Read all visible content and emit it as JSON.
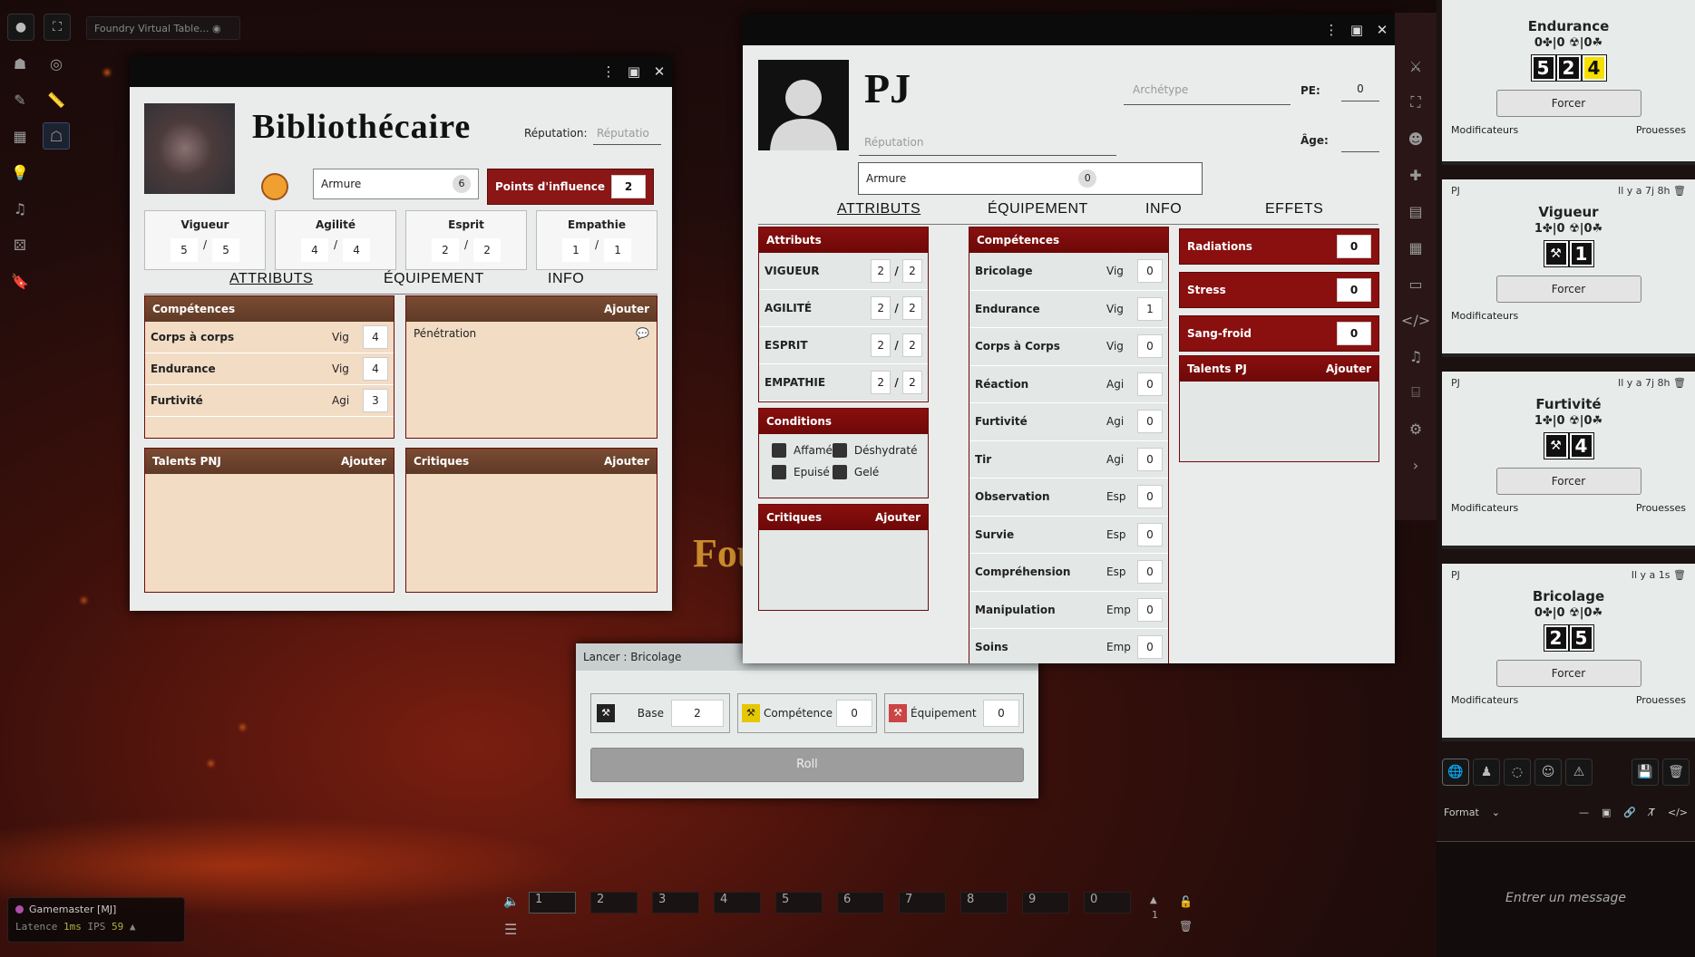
{
  "topbar": {
    "app_title": "Foundry Virtual Table..."
  },
  "npc": {
    "name": "Bibliothécaire",
    "reputation_label": "Réputation:",
    "reputation_placeholder": "Réputatio",
    "armor_label": "Armure",
    "armor_value": "6",
    "influence_label": "Points d'influence",
    "influence_value": "2",
    "attributes": [
      {
        "name": "Vigueur",
        "cur": "5",
        "max": "5"
      },
      {
        "name": "Agilité",
        "cur": "4",
        "max": "4"
      },
      {
        "name": "Esprit",
        "cur": "2",
        "max": "2"
      },
      {
        "name": "Empathie",
        "cur": "1",
        "max": "1"
      }
    ],
    "tabs": [
      "Attributs",
      "Équipement",
      "Info"
    ],
    "skills_title": "Compétences",
    "skills": [
      {
        "name": "Corps à corps",
        "attr": "Vig",
        "value": "4"
      },
      {
        "name": "Endurance",
        "attr": "Vig",
        "value": "4"
      },
      {
        "name": "Furtivité",
        "attr": "Agi",
        "value": "3"
      }
    ],
    "items_add": "Ajouter",
    "items": [
      "Pénétration"
    ],
    "talents_title": "Talents PNJ",
    "talents_add": "Ajouter",
    "crit_title": "Critiques",
    "crit_add": "Ajouter"
  },
  "pc": {
    "name": "PJ",
    "archetype_placeholder": "Archétype",
    "pe_label": "PE:",
    "pe_value": "0",
    "reputation_placeholder": "Réputation",
    "age_label": "Âge:",
    "armor_label": "Armure",
    "armor_value": "0",
    "tabs": [
      "Attributs",
      "Équipement",
      "Info",
      "Effets"
    ],
    "attr_title": "Attributs",
    "attributes": [
      {
        "name": "VIGUEUR",
        "cur": "2",
        "max": "2"
      },
      {
        "name": "AGILITÉ",
        "cur": "2",
        "max": "2"
      },
      {
        "name": "ESPRIT",
        "cur": "2",
        "max": "2"
      },
      {
        "name": "EMPATHIE",
        "cur": "2",
        "max": "2"
      }
    ],
    "conditions_title": "Conditions",
    "conditions": [
      "Affamé",
      "Déshydraté",
      "Epuisé",
      "Gelé"
    ],
    "crit_title": "Critiques",
    "crit_add": "Ajouter",
    "skills_title": "Compétences",
    "skills": [
      {
        "name": "Bricolage",
        "attr": "Vig",
        "value": "0"
      },
      {
        "name": "Endurance",
        "attr": "Vig",
        "value": "1"
      },
      {
        "name": "Corps à Corps",
        "attr": "Vig",
        "value": "0"
      },
      {
        "name": "Réaction",
        "attr": "Agi",
        "value": "0"
      },
      {
        "name": "Furtivité",
        "attr": "Agi",
        "value": "0"
      },
      {
        "name": "Tir",
        "attr": "Agi",
        "value": "0"
      },
      {
        "name": "Observation",
        "attr": "Esp",
        "value": "0"
      },
      {
        "name": "Survie",
        "attr": "Esp",
        "value": "0"
      },
      {
        "name": "Compréhension",
        "attr": "Esp",
        "value": "0"
      },
      {
        "name": "Manipulation",
        "attr": "Emp",
        "value": "0"
      },
      {
        "name": "Soins",
        "attr": "Emp",
        "value": "0"
      }
    ],
    "trackers": [
      {
        "name": "Radiations",
        "value": "0"
      },
      {
        "name": "Stress",
        "value": "0"
      },
      {
        "name": "Sang-froid",
        "value": "0"
      }
    ],
    "talents_title": "Talents PJ",
    "talents_add": "Ajouter"
  },
  "roll": {
    "title": "Lancer : Bricolage",
    "base_label": "Base",
    "base_value": "2",
    "skill_label": "Compétence",
    "skill_value": "0",
    "equip_label": "Équipement",
    "equip_value": "0",
    "roll_button": "Roll"
  },
  "chat": {
    "cards": [
      {
        "author": "",
        "time": "",
        "skill": "Endurance",
        "summary": "0✤|0 ☢|0☘",
        "dice": [
          "5",
          "2",
          "4"
        ],
        "yellow": [
          2
        ],
        "force": "Forcer",
        "mods": "Modificateurs",
        "feats": "Prouesses"
      },
      {
        "author": "PJ",
        "time": "Il y a 7j 8h",
        "skill": "Vigueur",
        "summary": "1✤|0 ☢|0☘",
        "dice": [
          "⚒",
          "1"
        ],
        "yellow": [],
        "force": "Forcer",
        "mods": "Modificateurs",
        "feats": ""
      },
      {
        "author": "PJ",
        "time": "Il y a 7j 8h",
        "skill": "Furtivité",
        "summary": "1✤|0 ☢|0☘",
        "dice": [
          "⚒",
          "4"
        ],
        "yellow": [],
        "force": "Forcer",
        "mods": "Modificateurs",
        "feats": "Prouesses"
      },
      {
        "author": "PJ",
        "time": "Il y a 1s",
        "skill": "Bricolage",
        "summary": "0✤|0 ☢|0☘",
        "dice": [
          "2",
          "5"
        ],
        "yellow": [],
        "force": "Forcer",
        "mods": "Modificateurs",
        "feats": "Prouesses"
      }
    ],
    "format_label": "Format",
    "message_placeholder": "Entrer un message"
  },
  "players": {
    "gm": "Gamemaster [MJ]",
    "latency_label": "Latence",
    "latency_value": "1ms",
    "fps_label": "IPS",
    "fps_value": "59"
  },
  "hotbar": {
    "slots": [
      "1",
      "2",
      "3",
      "4",
      "5",
      "6",
      "7",
      "8",
      "9",
      "0"
    ],
    "page": "1"
  },
  "background": {
    "logo_text": "Fou"
  }
}
